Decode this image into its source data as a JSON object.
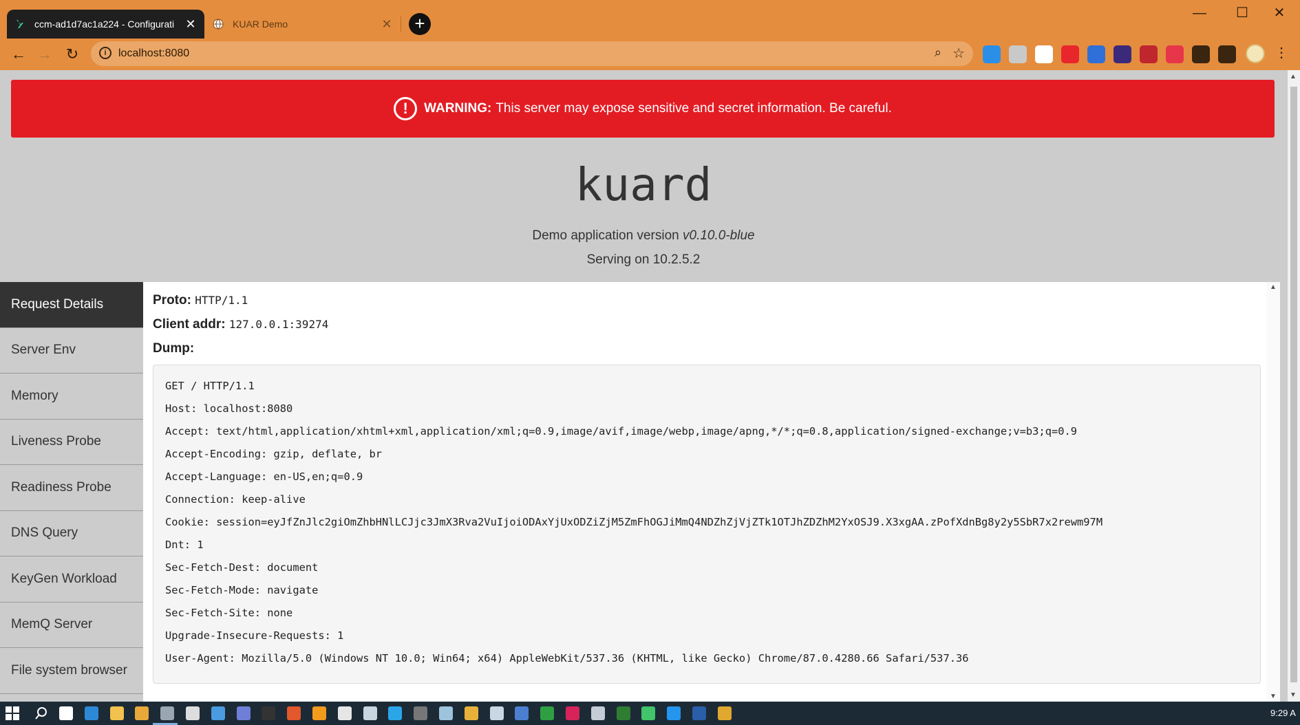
{
  "browser": {
    "tabs": [
      {
        "title": "ccm-ad1d7ac1a224 - Configurati",
        "active": true
      },
      {
        "title": "KUAR Demo",
        "active": false
      }
    ],
    "url": "localhost:8080",
    "theme_color": "#e58d3e"
  },
  "page": {
    "warning": {
      "label": "WARNING:",
      "message": "This server may expose sensitive and secret information. Be careful.",
      "color": "#e31c24"
    },
    "app_title": "kuard",
    "version_prefix": "Demo application version",
    "version": "v0.10.0-blue",
    "serving": "Serving on 10.2.5.2",
    "sidebar": {
      "items": [
        {
          "label": "Request Details",
          "active": true
        },
        {
          "label": "Server Env"
        },
        {
          "label": "Memory"
        },
        {
          "label": "Liveness Probe"
        },
        {
          "label": "Readiness Probe"
        },
        {
          "label": "DNS Query"
        },
        {
          "label": "KeyGen Workload"
        },
        {
          "label": "MemQ Server"
        },
        {
          "label": "File system browser"
        }
      ]
    },
    "request": {
      "proto_label": "Proto:",
      "proto": "HTTP/1.1",
      "client_label": "Client addr:",
      "client_addr": "127.0.0.1:39274",
      "dump_label": "Dump:",
      "dump_lines": [
        "GET / HTTP/1.1",
        "Host: localhost:8080",
        "Accept: text/html,application/xhtml+xml,application/xml;q=0.9,image/avif,image/webp,image/apng,*/*;q=0.8,application/signed-exchange;v=b3;q=0.9",
        "Accept-Encoding: gzip, deflate, br",
        "Accept-Language: en-US,en;q=0.9",
        "Connection: keep-alive",
        "Cookie: session=eyJfZnJlc2giOmZhbHNlLCJjc3JmX3Rva2VuIjoiODAxYjUxODZiZjM5ZmFhOGJiMmQ4NDZhZjVjZTk1OTJhZDZhM2YxOSJ9.X3xgAA.zPofXdnBg8y2y5SbR7x2rewm97M",
        "Dnt: 1",
        "Sec-Fetch-Dest: document",
        "Sec-Fetch-Mode: navigate",
        "Sec-Fetch-Site: none",
        "Upgrade-Insecure-Requests: 1",
        "User-Agent: Mozilla/5.0 (Windows NT 10.0; Win64; x64) AppleWebKit/537.36 (KHTML, like Gecko) Chrome/87.0.4280.66 Safari/537.36"
      ]
    }
  },
  "extensions": [
    {
      "name": "ext-blue-icon",
      "color": "#2b8fe8"
    },
    {
      "name": "ext-grey-icon",
      "color": "#c9c9c9"
    },
    {
      "name": "ext-cross-icon",
      "color": "#ffffff"
    },
    {
      "name": "ext-red-hand-icon",
      "color": "#e8262b"
    },
    {
      "name": "ext-shield-icon",
      "color": "#2f6fd8"
    },
    {
      "name": "ext-multicolor-icon",
      "color": "#3b2a7a"
    },
    {
      "name": "ext-ublock-icon",
      "color": "#c0262e"
    },
    {
      "name": "ext-pocket-icon",
      "color": "#e7364a"
    },
    {
      "name": "extensions-puzzle-icon",
      "color": "#3a2510"
    },
    {
      "name": "reading-list-icon",
      "color": "#3a2510"
    }
  ],
  "taskbar": {
    "clock": "9:29 A",
    "icons": [
      {
        "name": "task-view-icon",
        "color": "#ffffff"
      },
      {
        "name": "taskbar-app-1-icon",
        "color": "#2d89d8"
      },
      {
        "name": "file-explorer-icon",
        "color": "#f2c14e"
      },
      {
        "name": "chrome-icon",
        "color": "#e8a93a"
      },
      {
        "name": "taskbar-app-4-icon",
        "color": "#9aa7b3"
      },
      {
        "name": "settings-icon",
        "color": "#dddddd"
      },
      {
        "name": "taskbar-app-6-icon",
        "color": "#4a9be0"
      },
      {
        "name": "taskbar-app-7-icon",
        "color": "#6f7fd8"
      },
      {
        "name": "terminal-icon",
        "color": "#333333"
      },
      {
        "name": "taskbar-app-9-icon",
        "color": "#e2572b"
      },
      {
        "name": "taskbar-app-10-icon",
        "color": "#f39b1c"
      },
      {
        "name": "taskbar-app-11-icon",
        "color": "#e6e6e6"
      },
      {
        "name": "taskbar-app-12-icon",
        "color": "#c8d6e0"
      },
      {
        "name": "taskbar-app-13-icon",
        "color": "#2aa6e8"
      },
      {
        "name": "taskbar-app-14-icon",
        "color": "#777777"
      },
      {
        "name": "taskbar-app-15-icon",
        "color": "#9ec4dd"
      },
      {
        "name": "taskbar-app-16-icon",
        "color": "#e8b23a"
      },
      {
        "name": "taskbar-app-17-icon",
        "color": "#c9d6e3"
      },
      {
        "name": "taskbar-app-18-icon",
        "color": "#4d7fd1"
      },
      {
        "name": "taskbar-app-19-icon",
        "color": "#2ea043"
      },
      {
        "name": "taskbar-app-20-icon",
        "color": "#d6245a"
      },
      {
        "name": "taskbar-app-21-icon",
        "color": "#c4cdd6"
      },
      {
        "name": "taskbar-app-22-icon",
        "color": "#2e7d32"
      },
      {
        "name": "taskbar-app-23-icon",
        "color": "#41c46a"
      },
      {
        "name": "taskbar-app-24-icon",
        "color": "#2496ed"
      },
      {
        "name": "powershell-icon",
        "color": "#2a5ea8"
      },
      {
        "name": "git-icon",
        "color": "#e0a82e"
      }
    ]
  }
}
